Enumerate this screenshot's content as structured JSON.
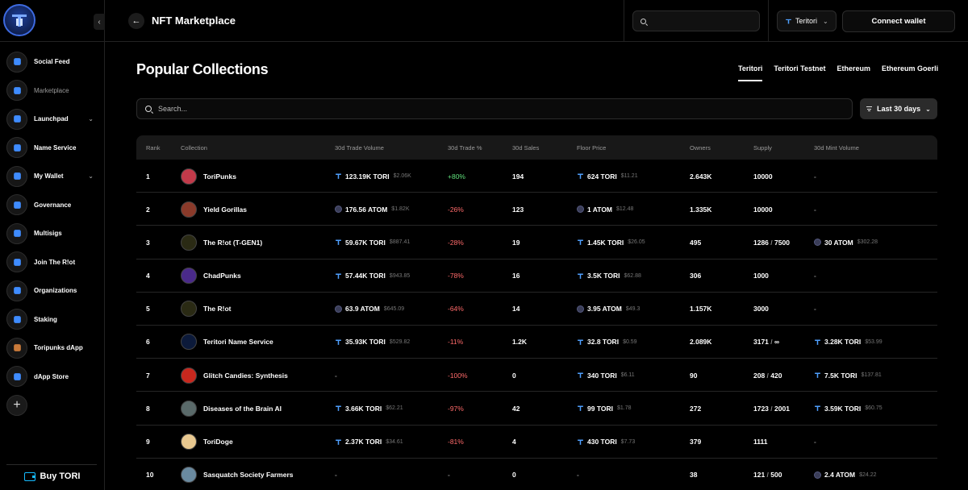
{
  "sidebar": {
    "items": [
      {
        "label": "Social Feed",
        "icon": "social-feed-icon",
        "color": "#3f8cff",
        "active": false,
        "chevron": false
      },
      {
        "label": "Marketplace",
        "icon": "marketplace-icon",
        "color": "#3f8cff",
        "active": true,
        "chevron": false
      },
      {
        "label": "Launchpad",
        "icon": "rocket-icon",
        "color": "#3f8cff",
        "active": false,
        "chevron": true
      },
      {
        "label": "Name Service",
        "icon": "name-service-icon",
        "color": "#3f8cff",
        "active": false,
        "chevron": false
      },
      {
        "label": "My Wallet",
        "icon": "wallet-icon",
        "color": "#3f8cff",
        "active": false,
        "chevron": true
      },
      {
        "label": "Governance",
        "icon": "governance-icon",
        "color": "#3f8cff",
        "active": false,
        "chevron": false
      },
      {
        "label": "Multisigs",
        "icon": "multisig-icon",
        "color": "#3f8cff",
        "active": false,
        "chevron": false
      },
      {
        "label": "Join The R!ot",
        "icon": "riot-icon",
        "color": "#3f8cff",
        "active": false,
        "chevron": false
      },
      {
        "label": "Organizations",
        "icon": "organizations-icon",
        "color": "#3f8cff",
        "active": false,
        "chevron": false
      },
      {
        "label": "Staking",
        "icon": "staking-icon",
        "color": "#3f8cff",
        "active": false,
        "chevron": false
      },
      {
        "label": "Toripunks dApp",
        "icon": "toripunks-icon",
        "color": "#c97a3a",
        "active": false,
        "chevron": false
      },
      {
        "label": "dApp Store",
        "icon": "dapp-store-icon",
        "color": "#3f8cff",
        "active": false,
        "chevron": false
      }
    ],
    "add_label": "+",
    "buy_label": "Buy TORI"
  },
  "header": {
    "title": "NFT Marketplace",
    "search_placeholder": "",
    "network": "Teritori",
    "connect_label": "Connect wallet"
  },
  "main": {
    "section_title": "Popular Collections",
    "network_tabs": [
      "Teritori",
      "Teritori Testnet",
      "Ethereum",
      "Ethereum Goerli"
    ],
    "active_tab": 0,
    "search_placeholder": "Search...",
    "period": "Last 30 days"
  },
  "table": {
    "headers": [
      "Rank",
      "Collection",
      "30d Trade Volume",
      "30d Trade %",
      "30d Sales",
      "Floor Price",
      "Owners",
      "Supply",
      "30d Mint Volume"
    ],
    "rows": [
      {
        "rank": "1",
        "name": "ToriPunks",
        "avatar_color": "#c23a4a",
        "vol": "123.19K TORI",
        "vol_usd": "$2.06K",
        "vol_tok": "tori",
        "pct": "+80%",
        "pct_cls": "pos",
        "sales": "194",
        "floor": "624 TORI",
        "floor_usd": "$11.21",
        "floor_tok": "tori",
        "owners": "2.643K",
        "supply": "10000",
        "supply_total": "",
        "mint": "-",
        "mint_usd": "",
        "mint_tok": ""
      },
      {
        "rank": "2",
        "name": "Yield Gorillas",
        "avatar_color": "#8a3a2a",
        "vol": "176.56 ATOM",
        "vol_usd": "$1.82K",
        "vol_tok": "atom",
        "pct": "-26%",
        "pct_cls": "neg",
        "sales": "123",
        "floor": "1 ATOM",
        "floor_usd": "$12.48",
        "floor_tok": "atom",
        "owners": "1.335K",
        "supply": "10000",
        "supply_total": "",
        "mint": "-",
        "mint_usd": "",
        "mint_tok": ""
      },
      {
        "rank": "3",
        "name": "The R!ot (T-GEN1)",
        "avatar_color": "#2a2a14",
        "vol": "59.67K TORI",
        "vol_usd": "$887.41",
        "vol_tok": "tori",
        "pct": "-28%",
        "pct_cls": "neg",
        "sales": "19",
        "floor": "1.45K TORI",
        "floor_usd": "$26.05",
        "floor_tok": "tori",
        "owners": "495",
        "supply": "1286",
        "supply_total": "7500",
        "mint": "30 ATOM",
        "mint_usd": "$302.28",
        "mint_tok": "atom"
      },
      {
        "rank": "4",
        "name": "ChadPunks",
        "avatar_color": "#4a2a8a",
        "vol": "57.44K TORI",
        "vol_usd": "$943.85",
        "vol_tok": "tori",
        "pct": "-78%",
        "pct_cls": "neg",
        "sales": "16",
        "floor": "3.5K TORI",
        "floor_usd": "$62.88",
        "floor_tok": "tori",
        "owners": "306",
        "supply": "1000",
        "supply_total": "",
        "mint": "-",
        "mint_usd": "",
        "mint_tok": ""
      },
      {
        "rank": "5",
        "name": "The R!ot",
        "avatar_color": "#2a2a14",
        "vol": "63.9 ATOM",
        "vol_usd": "$645.09",
        "vol_tok": "atom",
        "pct": "-64%",
        "pct_cls": "neg",
        "sales": "14",
        "floor": "3.95 ATOM",
        "floor_usd": "$49.3",
        "floor_tok": "atom",
        "owners": "1.157K",
        "supply": "3000",
        "supply_total": "",
        "mint": "-",
        "mint_usd": "",
        "mint_tok": ""
      },
      {
        "rank": "6",
        "name": "Teritori Name Service",
        "avatar_color": "#0c1a3a",
        "vol": "35.93K TORI",
        "vol_usd": "$529.82",
        "vol_tok": "tori",
        "pct": "-11%",
        "pct_cls": "neg",
        "sales": "1.2K",
        "floor": "32.8 TORI",
        "floor_usd": "$0.59",
        "floor_tok": "tori",
        "owners": "2.089K",
        "supply": "3171",
        "supply_total": "∞",
        "mint": "3.28K TORI",
        "mint_usd": "$53.99",
        "mint_tok": "tori"
      },
      {
        "rank": "7",
        "name": "Glitch Candies: Synthesis",
        "avatar_color": "#c8281e",
        "vol": "-",
        "vol_usd": "",
        "vol_tok": "",
        "pct": "-100%",
        "pct_cls": "neg",
        "sales": "0",
        "floor": "340 TORI",
        "floor_usd": "$6.11",
        "floor_tok": "tori",
        "owners": "90",
        "supply": "208",
        "supply_total": "420",
        "mint": "7.5K TORI",
        "mint_usd": "$137.81",
        "mint_tok": "tori"
      },
      {
        "rank": "8",
        "name": "Diseases of the Brain AI",
        "avatar_color": "#5a6a6a",
        "vol": "3.66K TORI",
        "vol_usd": "$62.21",
        "vol_tok": "tori",
        "pct": "-97%",
        "pct_cls": "neg",
        "sales": "42",
        "floor": "99 TORI",
        "floor_usd": "$1.78",
        "floor_tok": "tori",
        "owners": "272",
        "supply": "1723",
        "supply_total": "2001",
        "mint": "3.59K TORI",
        "mint_usd": "$60.75",
        "mint_tok": "tori"
      },
      {
        "rank": "9",
        "name": "ToriDoge",
        "avatar_color": "#e8c890",
        "vol": "2.37K TORI",
        "vol_usd": "$34.61",
        "vol_tok": "tori",
        "pct": "-81%",
        "pct_cls": "neg",
        "sales": "4",
        "floor": "430 TORI",
        "floor_usd": "$7.73",
        "floor_tok": "tori",
        "owners": "379",
        "supply": "1111",
        "supply_total": "",
        "mint": "-",
        "mint_usd": "",
        "mint_tok": ""
      },
      {
        "rank": "10",
        "name": "Sasquatch Society Farmers",
        "avatar_color": "#6a8aa0",
        "vol": "-",
        "vol_usd": "",
        "vol_tok": "",
        "pct": "-",
        "pct_cls": "dim",
        "sales": "0",
        "floor": "-",
        "floor_usd": "",
        "floor_tok": "",
        "owners": "38",
        "supply": "121",
        "supply_total": "500",
        "mint": "2.4 ATOM",
        "mint_usd": "$24.22",
        "mint_tok": "atom"
      }
    ]
  }
}
